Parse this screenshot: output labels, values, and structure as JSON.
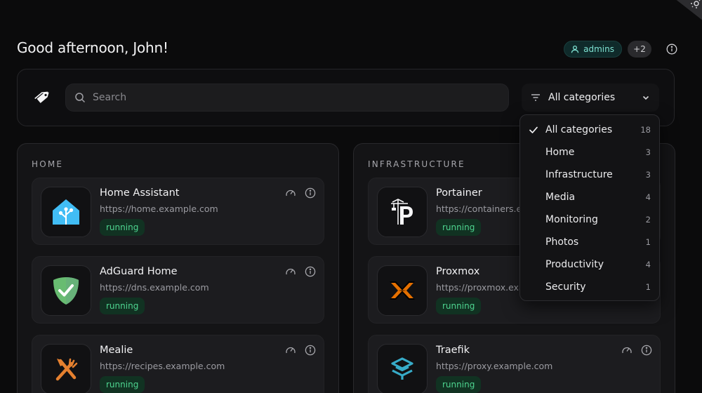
{
  "greeting": "Good afternoon, John!",
  "user": {
    "group": "admins",
    "extra_groups": "+2"
  },
  "search": {
    "placeholder": "Search"
  },
  "category_select": {
    "selected": "All categories"
  },
  "dropdown": {
    "items": [
      {
        "label": "All categories",
        "count": "18",
        "selected": true
      },
      {
        "label": "Home",
        "count": "3"
      },
      {
        "label": "Infrastructure",
        "count": "3"
      },
      {
        "label": "Media",
        "count": "4"
      },
      {
        "label": "Monitoring",
        "count": "2"
      },
      {
        "label": "Photos",
        "count": "1"
      },
      {
        "label": "Productivity",
        "count": "4"
      },
      {
        "label": "Security",
        "count": "1"
      }
    ]
  },
  "sections": {
    "home": {
      "title": "HOME",
      "apps": [
        {
          "name": "Home Assistant",
          "url": "https://home.example.com",
          "status": "running",
          "icon": "home-assistant-icon"
        },
        {
          "name": "AdGuard Home",
          "url": "https://dns.example.com",
          "status": "running",
          "icon": "adguard-shield-icon"
        },
        {
          "name": "Mealie",
          "url": "https://recipes.example.com",
          "status": "running",
          "icon": "mealie-fork-knife-icon"
        }
      ]
    },
    "infrastructure": {
      "title": "INFRASTRUCTURE",
      "apps": [
        {
          "name": "Portainer",
          "url": "https://containers.exa",
          "status": "running",
          "icon": "portainer-crane-icon"
        },
        {
          "name": "Proxmox",
          "url": "https://proxmox.exam",
          "status": "running",
          "icon": "proxmox-x-icon"
        },
        {
          "name": "Traefik",
          "url": "https://proxy.example.com",
          "status": "running",
          "icon": "traefik-icon"
        }
      ]
    }
  },
  "colors": {
    "accent_teal": "#7fe3d3",
    "status_green": "#4ed590",
    "status_bg": "#113222",
    "background": "#0b0b0c"
  }
}
